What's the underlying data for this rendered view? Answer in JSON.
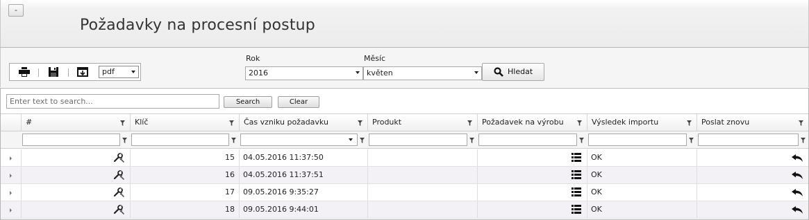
{
  "header": {
    "collapse_label": "-",
    "title": "Požadavky na procesní postup"
  },
  "filters": {
    "format": "pdf",
    "year_label": "Rok",
    "year_value": "2016",
    "month_label": "Měsíc",
    "month_value": "květen",
    "search_label": "Hledat"
  },
  "grid": {
    "search_placeholder": "Enter text to search...",
    "search_button": "Search",
    "clear_button": "Clear",
    "columns": [
      "#",
      "Klíč",
      "Čas vzniku požadavku",
      "Produkt",
      "Požadavek na výrobu",
      "Výsledek importu",
      "Poslat znovu"
    ],
    "rows": [
      {
        "klic": "15",
        "cas": "04.05.2016 11:37:50",
        "produkt": "",
        "vysledek": "OK"
      },
      {
        "klic": "16",
        "cas": "04.05.2016 11:37:51",
        "produkt": "",
        "vysledek": "OK"
      },
      {
        "klic": "17",
        "cas": "09.05.2016 9:35:27",
        "produkt": "",
        "vysledek": "OK"
      },
      {
        "klic": "18",
        "cas": "09.05.2016 9:44:01",
        "produkt": "",
        "vysledek": "OK"
      }
    ]
  },
  "icons": {
    "print": "printer-icon",
    "save": "floppy-disk-icon",
    "export": "export-window-icon",
    "search": "magnifier-icon",
    "row_detail": "wrench-icon",
    "request": "list-icon",
    "resend": "reply-arrow-icon",
    "filter": "funnel-icon"
  }
}
